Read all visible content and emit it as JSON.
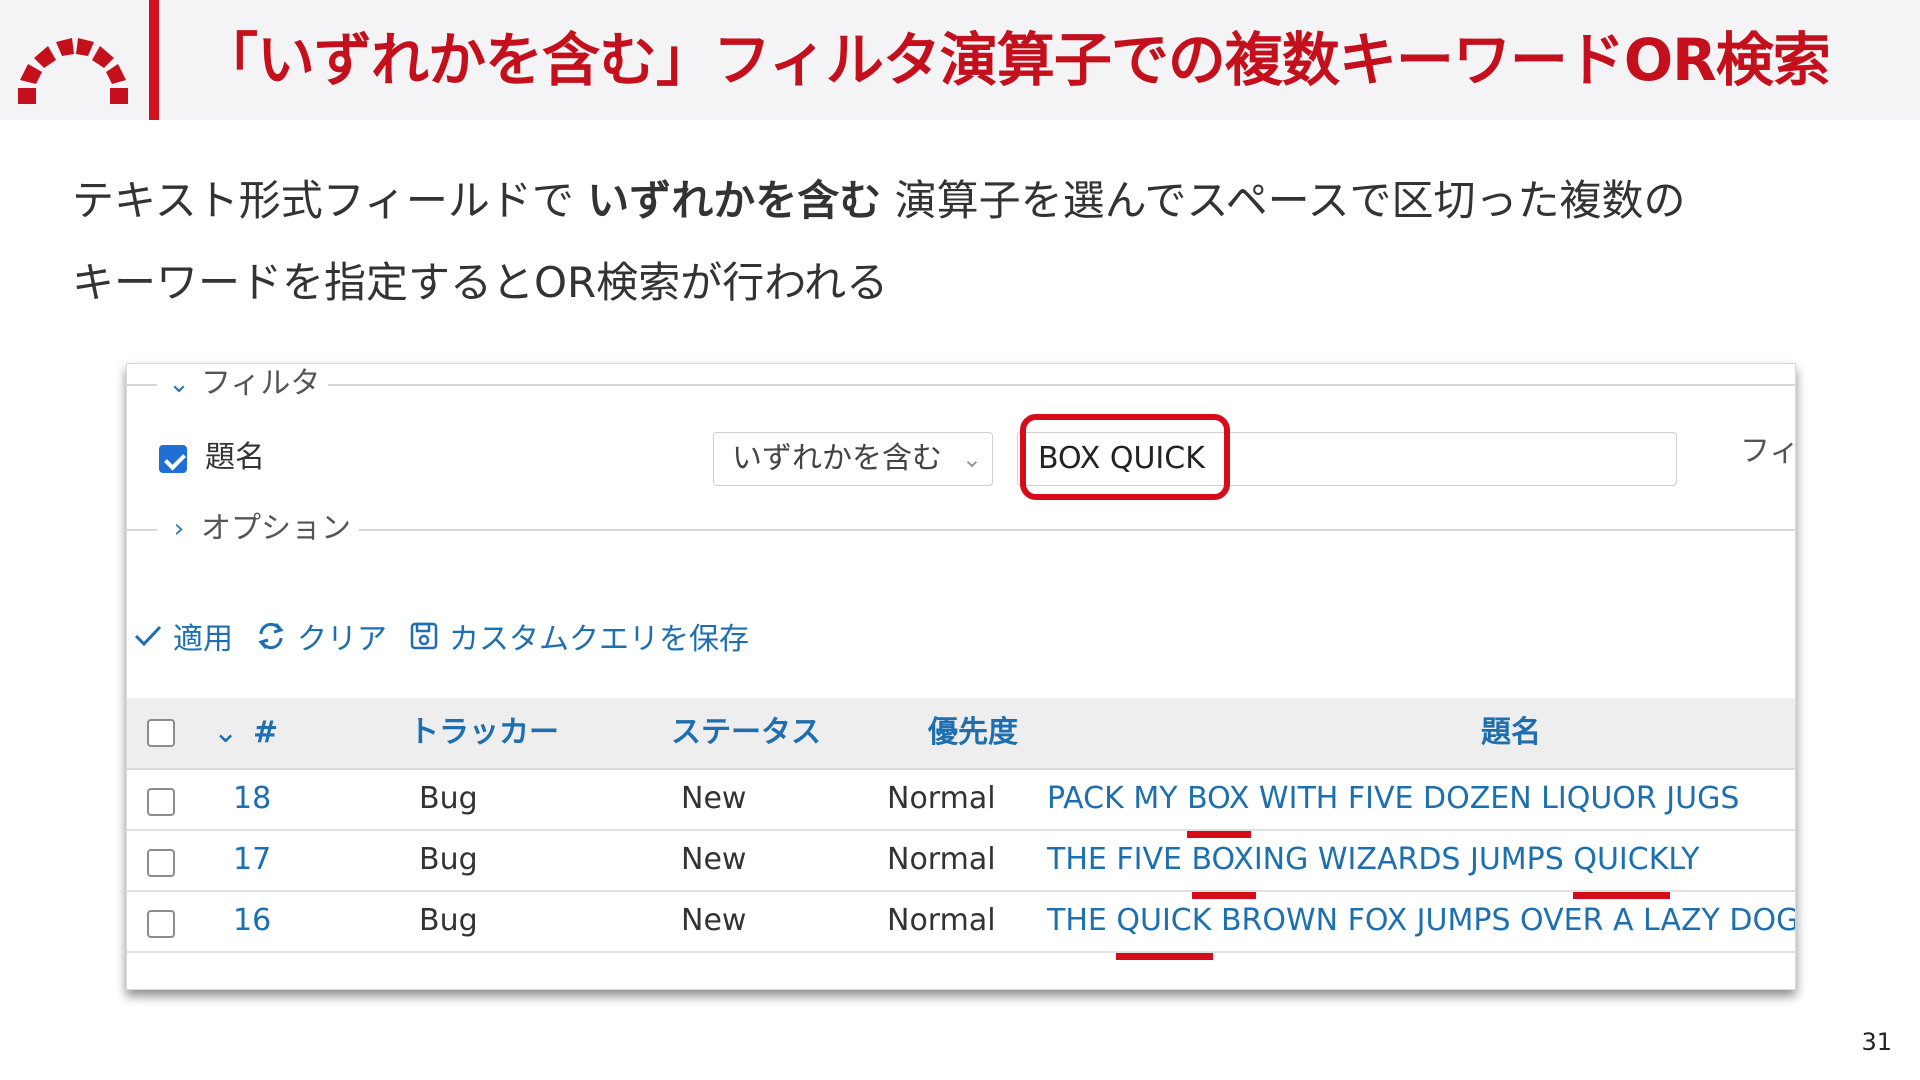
{
  "slide": {
    "title": "「いずれかを含む」フィルタ演算子での複数キーワードOR検索",
    "description": {
      "line1_before": "テキスト形式フィールドで ",
      "line1_strong": "いずれかを含む",
      "line1_after": " 演算子を選んでスペースで区切った複数の",
      "line2": "キーワードを指定するとOR検索が行われる"
    },
    "page_number": "31",
    "accent_color": "#d1121e"
  },
  "filter_panel": {
    "legend": "フィルタ",
    "field_label": "題名",
    "field_checked": true,
    "operator": "いずれかを含む",
    "value": "BOX QUICK",
    "next_label_partial": "フィ",
    "options_legend": "オプション"
  },
  "actions": {
    "apply": "適用",
    "clear": "クリア",
    "save": "カスタムクエリを保存"
  },
  "table": {
    "headers": {
      "id": "#",
      "tracker": "トラッカー",
      "status": "ステータス",
      "priority": "優先度",
      "subject": "題名"
    },
    "rows": [
      {
        "id": "18",
        "tracker": "Bug",
        "status": "New",
        "priority": "Normal",
        "subject": {
          "a": "PACK MY ",
          "m1": "BOX",
          "b": " WITH FIVE DOZEN LIQUOR JUGS",
          "m2": "",
          "c": ""
        }
      },
      {
        "id": "17",
        "tracker": "Bug",
        "status": "New",
        "priority": "Normal",
        "subject": {
          "a": "THE FIVE ",
          "m1": "BOX",
          "b": "ING WIZARDS JUMPS ",
          "m2": "QUICK",
          "c": "LY"
        }
      },
      {
        "id": "16",
        "tracker": "Bug",
        "status": "New",
        "priority": "Normal",
        "subject": {
          "a": "THE ",
          "m1": "QUICK",
          "b": " BROWN FOX JUMPS OVER A LAZY DOG",
          "m2": "",
          "c": ""
        }
      }
    ]
  }
}
